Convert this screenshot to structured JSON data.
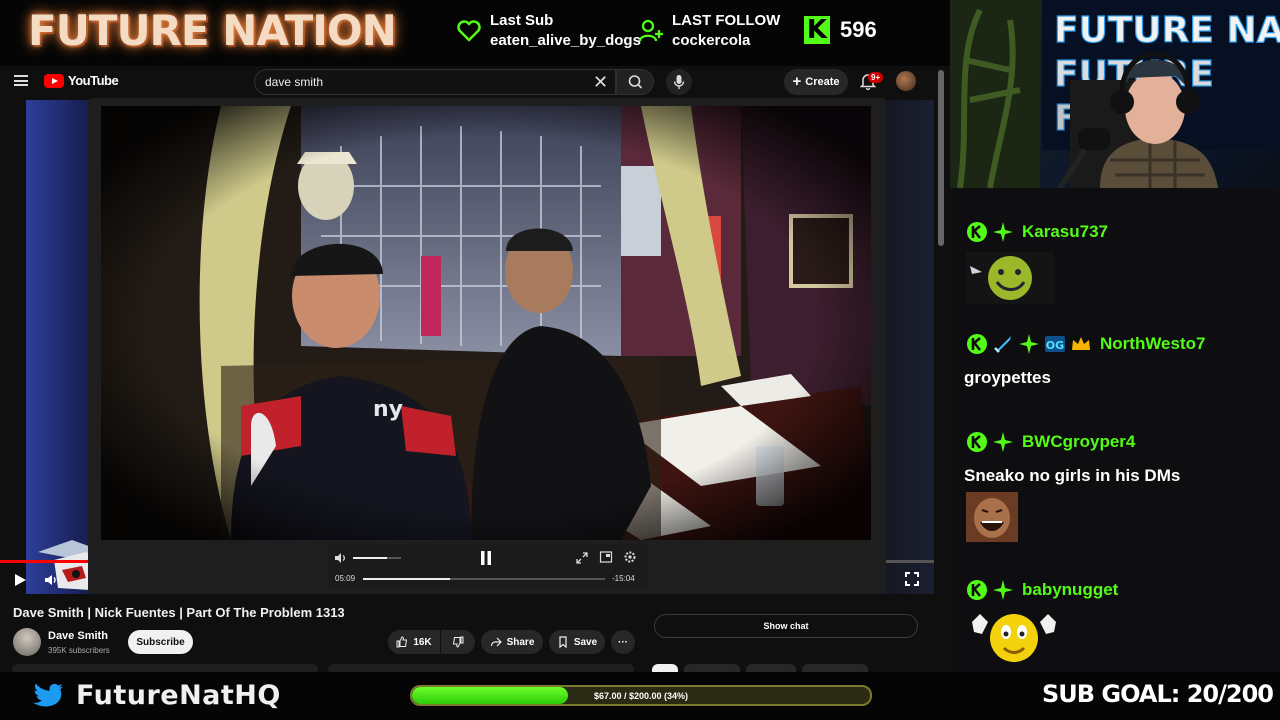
{
  "overlay": {
    "brand_title": "FUTURE NATION",
    "last_sub": {
      "label": "Last Sub",
      "value": "eaten_alive_by_dogs"
    },
    "last_follow": {
      "label": "LAST FOLLOW",
      "value": "cockercola"
    },
    "viewer_count": "596",
    "accent_color": "#53fc18"
  },
  "browser": {
    "logo_text": "YouTube",
    "search": {
      "value": "dave smith"
    },
    "create_label": "Create",
    "notification_badge": "9+",
    "player": {
      "current_time": "05:09",
      "remaining_time": "-15:04",
      "progress": 0.36,
      "volume": 0.7,
      "mini_progress": 0.105
    },
    "video": {
      "title": "Dave Smith | Nick Fuentes | Part Of The Problem 1313",
      "channel": "Dave Smith",
      "subscribers": "395K subscribers",
      "subscribe_label": "Subscribe",
      "likes": "16K",
      "share_label": "Share",
      "save_label": "Save",
      "more_label": "···",
      "show_chat_label": "Show chat"
    }
  },
  "chat": {
    "messages": [
      {
        "user": "Karasu737",
        "text": "",
        "emote": "green-smiley-emote"
      },
      {
        "user": "NorthWesto7",
        "text": "groypettes",
        "emote": ""
      },
      {
        "user": "BWCgroyper4",
        "text": "Sneako no girls in his DMs",
        "emote": "laughing-man-emote"
      },
      {
        "user": "babynugget",
        "text": "",
        "emote": "yellow-face-emote"
      }
    ]
  },
  "footer": {
    "handle": "FutureNatHQ",
    "goal_text": "$67.00 / $200.00 (34%)",
    "goal_fraction": 0.34,
    "sub_goal": "SUB GOAL: 20/200"
  }
}
